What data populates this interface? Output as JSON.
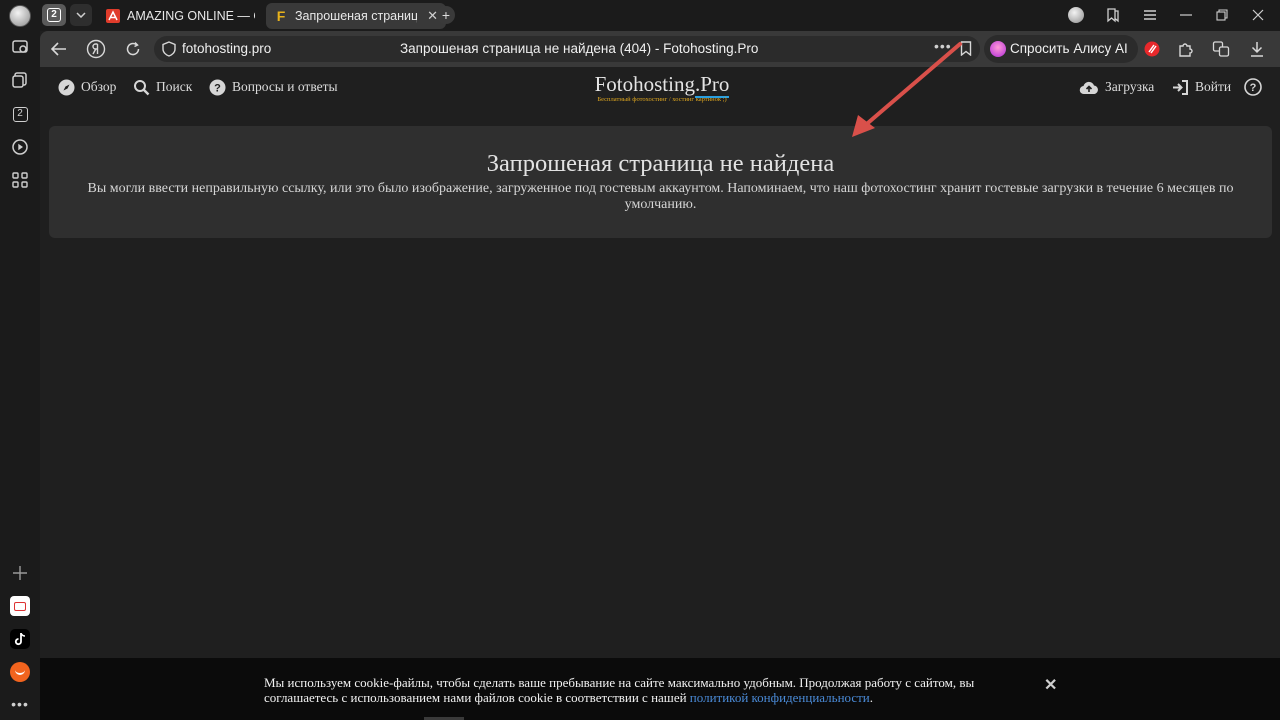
{
  "browser": {
    "tab_count": "2",
    "tabs": [
      {
        "label": "AMAZING ONLINE — Онлайн",
        "favicon": "amazing-favicon"
      },
      {
        "label": "Запрошеная страница не найдена",
        "favicon": "fotohosting-favicon",
        "active": true
      }
    ],
    "favicon_letter": "F",
    "address": {
      "url": "fotohosting.pro",
      "page_title": "Запрошеная страница не найдена (404) - Fotohosting.Pro"
    },
    "alice_label": "Спросить Алису AI",
    "colors": {
      "accent_pink": "#d24fd6",
      "favicon_yellow": "#e8b21b",
      "amazing_red": "#e03c2b"
    }
  },
  "site": {
    "nav": {
      "overview": "Обзор",
      "search": "Поиск",
      "faq": "Вопросы и ответы",
      "upload": "Загрузка",
      "login": "Войти"
    },
    "logo": {
      "title_main": "Fotohosting",
      "title_ext": ".Pro",
      "subtitle": "Бесплатный фотохостинг / хостинг картинок ;)"
    },
    "error": {
      "title": "Запрошеная страница не найдена",
      "message": "Вы могли ввести неправильную ссылку, или это было изображение, загруженное под гостевым аккаунтом. Напоминаем, что наш фотохостинг хранит гостевые загрузки в течение 6 месяцев по умолчанию."
    },
    "cookie": {
      "text": "Мы используем cookie-файлы, чтобы сделать ваше пребывание на сайте максимально удобным. Продолжая работу с сайтом, вы соглашаетесь с использованием нами файлов cookie в соответствии с нашей ",
      "link": "политикой конфиденциальности",
      "end": ".",
      "close": "✕"
    }
  }
}
